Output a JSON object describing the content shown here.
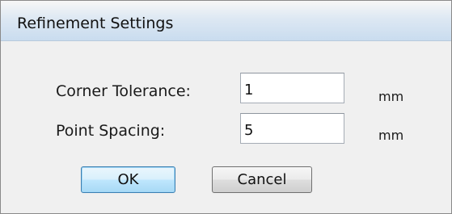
{
  "dialog": {
    "title": "Refinement Settings"
  },
  "fields": {
    "corner_tolerance": {
      "label": "Corner Tolerance:",
      "value": "1",
      "unit": "mm"
    },
    "point_spacing": {
      "label": "Point Spacing:",
      "value": "5",
      "unit": "mm"
    }
  },
  "buttons": {
    "ok_label": "OK",
    "cancel_label": "Cancel"
  }
}
